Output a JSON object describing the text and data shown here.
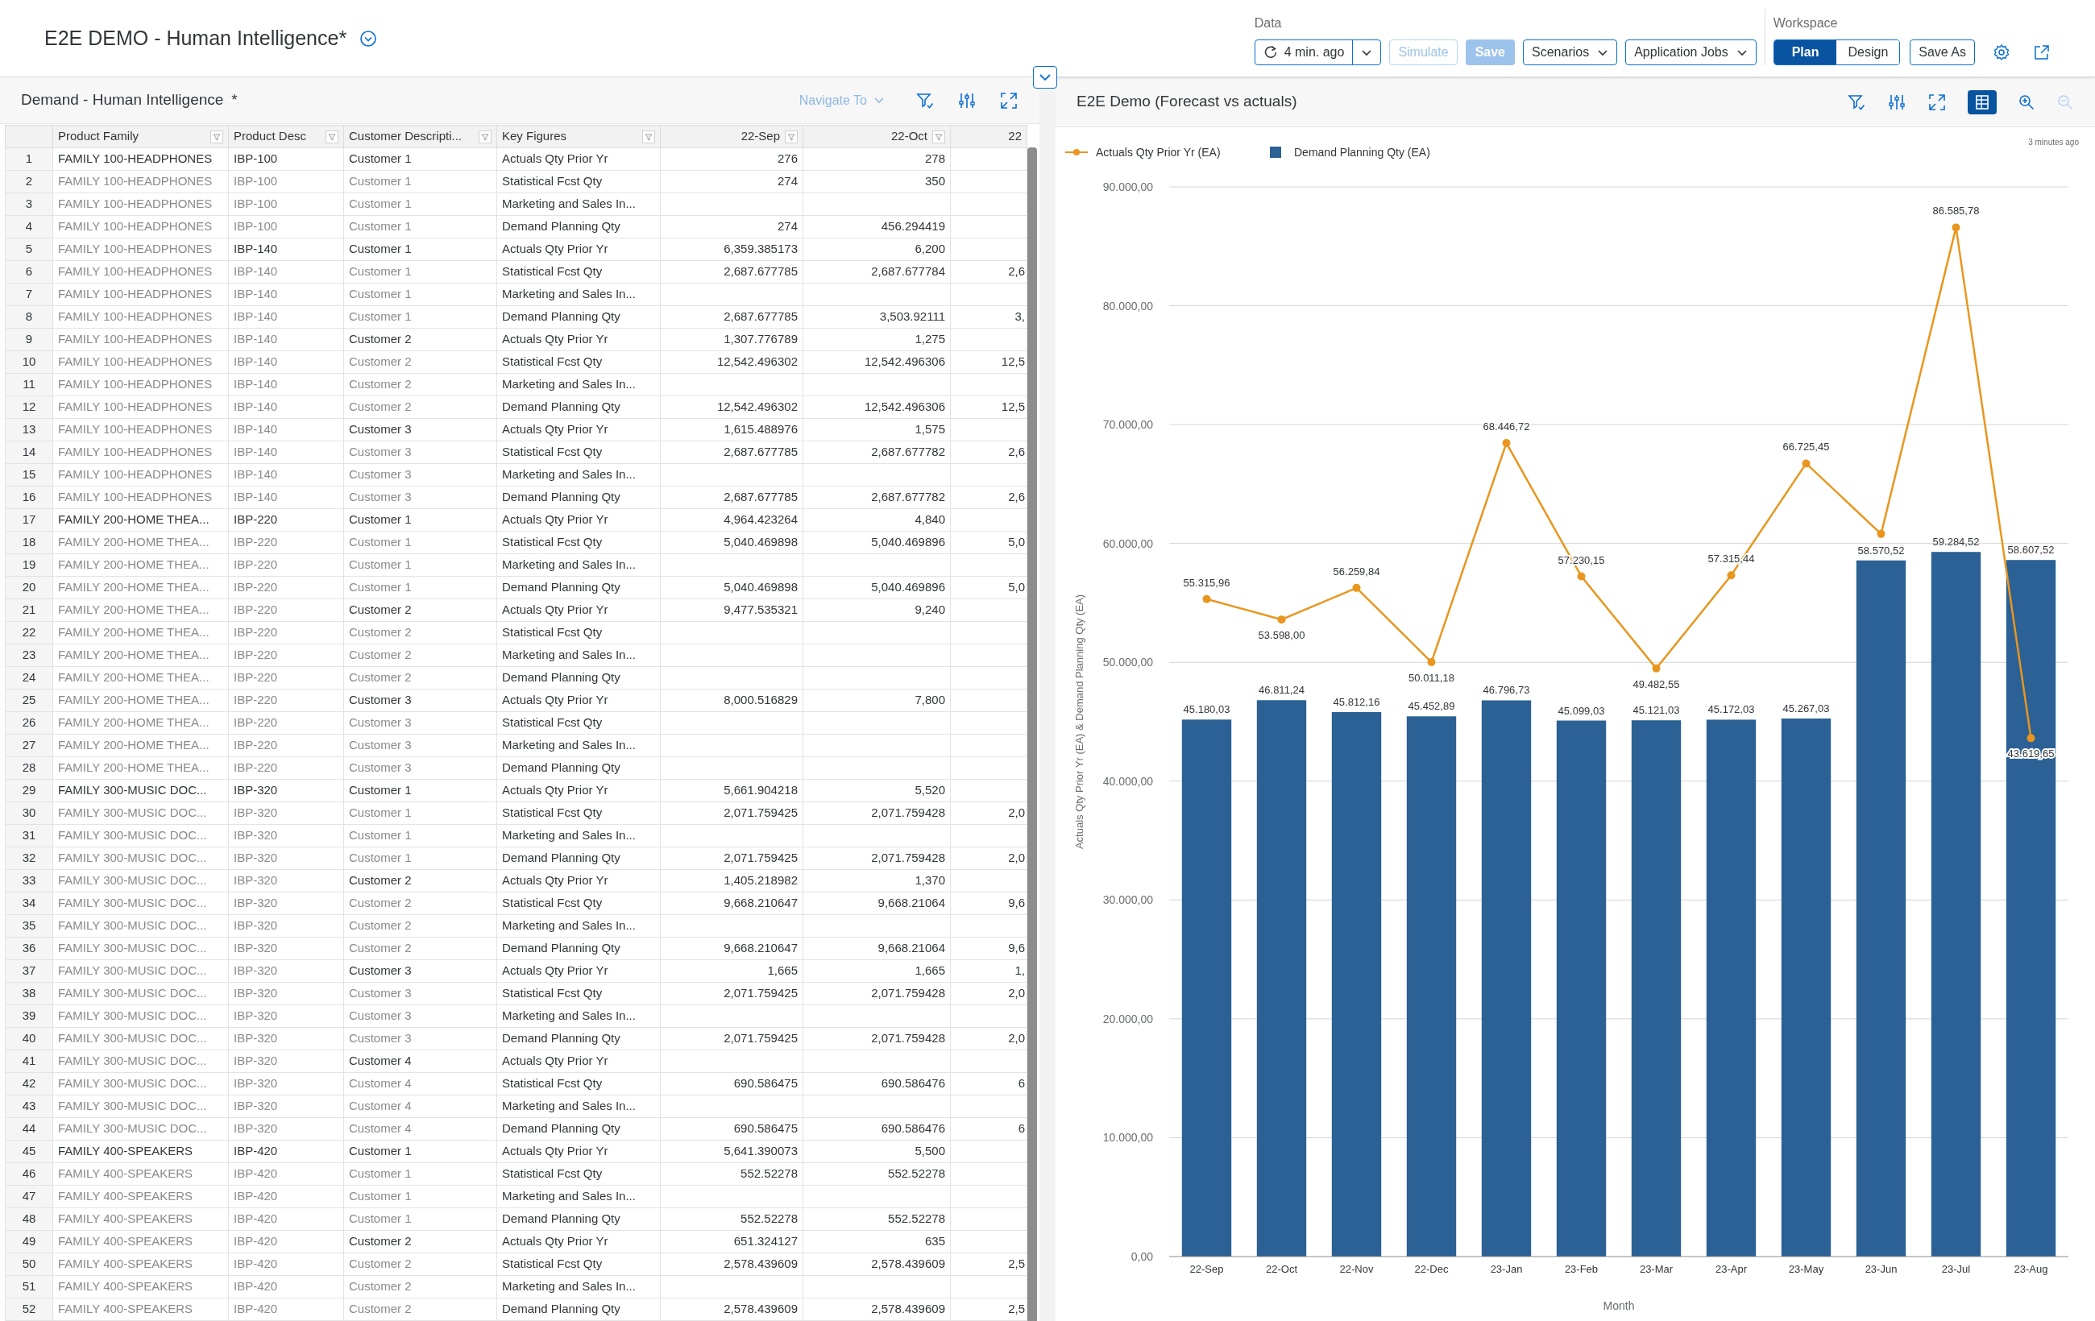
{
  "page": {
    "title": "E2E DEMO - Human Intelligence*"
  },
  "toolbar": {
    "data_group": {
      "label": "Data",
      "refresh_label": "4 min. ago",
      "simulate": {
        "label": "Simulate",
        "disabled": true
      },
      "save": {
        "label": "Save",
        "disabled": true
      },
      "menus": [
        "Scenarios",
        "Application Jobs"
      ]
    },
    "workspace_group": {
      "label": "Workspace",
      "modes": [
        {
          "label": "Plan",
          "selected": true
        },
        {
          "label": "Design",
          "selected": false
        }
      ],
      "save_as": "Save As"
    }
  },
  "table_panel": {
    "title": "Demand - Human Intelligence",
    "modified_mark": "*",
    "navigate_to": "Navigate To",
    "columns": [
      "Product Family",
      "Product Desc",
      "Customer Descripti...",
      "Key Figures",
      "22-Sep",
      "22-Oct",
      "22"
    ],
    "rows": [
      {
        "n": "1",
        "cells": [
          "FAMILY 100-HEADPHONES",
          "IBP-100",
          "Customer 1",
          "Actuals Qty Prior Yr",
          "276",
          "278",
          null
        ],
        "dim": [
          false,
          false,
          false
        ]
      },
      {
        "n": "2",
        "cells": [
          "FAMILY 100-HEADPHONES",
          "IBP-100",
          "Customer 1",
          "Statistical Fcst Qty",
          "274",
          "350",
          null
        ],
        "dim": [
          true,
          true,
          true
        ]
      },
      {
        "n": "3",
        "cells": [
          "FAMILY 100-HEADPHONES",
          "IBP-100",
          "Customer 1",
          "Marketing and Sales In...",
          null,
          null,
          null
        ],
        "dim": [
          true,
          true,
          true
        ]
      },
      {
        "n": "4",
        "cells": [
          "FAMILY 100-HEADPHONES",
          "IBP-100",
          "Customer 1",
          "Demand Planning Qty",
          "274",
          "456.294419",
          null
        ],
        "dim": [
          true,
          true,
          true
        ]
      },
      {
        "n": "5",
        "cells": [
          "FAMILY 100-HEADPHONES",
          "IBP-140",
          "Customer 1",
          "Actuals Qty Prior Yr",
          "6,359.385173",
          "6,200",
          null
        ],
        "dim": [
          true,
          false,
          false
        ]
      },
      {
        "n": "6",
        "cells": [
          "FAMILY 100-HEADPHONES",
          "IBP-140",
          "Customer 1",
          "Statistical Fcst Qty",
          "2,687.677785",
          "2,687.677784",
          "2,6"
        ],
        "dim": [
          true,
          true,
          true
        ]
      },
      {
        "n": "7",
        "cells": [
          "FAMILY 100-HEADPHONES",
          "IBP-140",
          "Customer 1",
          "Marketing and Sales In...",
          null,
          null,
          null
        ],
        "dim": [
          true,
          true,
          true
        ]
      },
      {
        "n": "8",
        "cells": [
          "FAMILY 100-HEADPHONES",
          "IBP-140",
          "Customer 1",
          "Demand Planning Qty",
          "2,687.677785",
          "3,503.92111",
          "3,"
        ],
        "dim": [
          true,
          true,
          true
        ]
      },
      {
        "n": "9",
        "cells": [
          "FAMILY 100-HEADPHONES",
          "IBP-140",
          "Customer 2",
          "Actuals Qty Prior Yr",
          "1,307.776789",
          "1,275",
          null
        ],
        "dim": [
          true,
          true,
          false
        ]
      },
      {
        "n": "10",
        "cells": [
          "FAMILY 100-HEADPHONES",
          "IBP-140",
          "Customer 2",
          "Statistical Fcst Qty",
          "12,542.496302",
          "12,542.496306",
          "12,5"
        ],
        "dim": [
          true,
          true,
          true
        ]
      },
      {
        "n": "11",
        "cells": [
          "FAMILY 100-HEADPHONES",
          "IBP-140",
          "Customer 2",
          "Marketing and Sales In...",
          null,
          null,
          null
        ],
        "dim": [
          true,
          true,
          true
        ]
      },
      {
        "n": "12",
        "cells": [
          "FAMILY 100-HEADPHONES",
          "IBP-140",
          "Customer 2",
          "Demand Planning Qty",
          "12,542.496302",
          "12,542.496306",
          "12,5"
        ],
        "dim": [
          true,
          true,
          true
        ]
      },
      {
        "n": "13",
        "cells": [
          "FAMILY 100-HEADPHONES",
          "IBP-140",
          "Customer 3",
          "Actuals Qty Prior Yr",
          "1,615.488976",
          "1,575",
          null
        ],
        "dim": [
          true,
          true,
          false
        ]
      },
      {
        "n": "14",
        "cells": [
          "FAMILY 100-HEADPHONES",
          "IBP-140",
          "Customer 3",
          "Statistical Fcst Qty",
          "2,687.677785",
          "2,687.677782",
          "2,6"
        ],
        "dim": [
          true,
          true,
          true
        ]
      },
      {
        "n": "15",
        "cells": [
          "FAMILY 100-HEADPHONES",
          "IBP-140",
          "Customer 3",
          "Marketing and Sales In...",
          null,
          null,
          null
        ],
        "dim": [
          true,
          true,
          true
        ]
      },
      {
        "n": "16",
        "cells": [
          "FAMILY 100-HEADPHONES",
          "IBP-140",
          "Customer 3",
          "Demand Planning Qty",
          "2,687.677785",
          "2,687.677782",
          "2,6"
        ],
        "dim": [
          true,
          true,
          true
        ]
      },
      {
        "n": "17",
        "cells": [
          "FAMILY 200-HOME THEA...",
          "IBP-220",
          "Customer 1",
          "Actuals Qty Prior Yr",
          "4,964.423264",
          "4,840",
          null
        ],
        "dim": [
          false,
          false,
          false
        ]
      },
      {
        "n": "18",
        "cells": [
          "FAMILY 200-HOME THEA...",
          "IBP-220",
          "Customer 1",
          "Statistical Fcst Qty",
          "5,040.469898",
          "5,040.469896",
          "5,0"
        ],
        "dim": [
          true,
          true,
          true
        ]
      },
      {
        "n": "19",
        "cells": [
          "FAMILY 200-HOME THEA...",
          "IBP-220",
          "Customer 1",
          "Marketing and Sales In...",
          null,
          null,
          null
        ],
        "dim": [
          true,
          true,
          true
        ]
      },
      {
        "n": "20",
        "cells": [
          "FAMILY 200-HOME THEA...",
          "IBP-220",
          "Customer 1",
          "Demand Planning Qty",
          "5,040.469898",
          "5,040.469896",
          "5,0"
        ],
        "dim": [
          true,
          true,
          true
        ]
      },
      {
        "n": "21",
        "cells": [
          "FAMILY 200-HOME THEA...",
          "IBP-220",
          "Customer 2",
          "Actuals Qty Prior Yr",
          "9,477.535321",
          "9,240",
          null
        ],
        "dim": [
          true,
          true,
          false
        ]
      },
      {
        "n": "22",
        "cells": [
          "FAMILY 200-HOME THEA...",
          "IBP-220",
          "Customer 2",
          "Statistical Fcst Qty",
          null,
          null,
          null
        ],
        "dim": [
          true,
          true,
          true
        ]
      },
      {
        "n": "23",
        "cells": [
          "FAMILY 200-HOME THEA...",
          "IBP-220",
          "Customer 2",
          "Marketing and Sales In...",
          null,
          null,
          null
        ],
        "dim": [
          true,
          true,
          true
        ]
      },
      {
        "n": "24",
        "cells": [
          "FAMILY 200-HOME THEA...",
          "IBP-220",
          "Customer 2",
          "Demand Planning Qty",
          null,
          null,
          null
        ],
        "dim": [
          true,
          true,
          true
        ]
      },
      {
        "n": "25",
        "cells": [
          "FAMILY 200-HOME THEA...",
          "IBP-220",
          "Customer 3",
          "Actuals Qty Prior Yr",
          "8,000.516829",
          "7,800",
          null
        ],
        "dim": [
          true,
          true,
          false
        ]
      },
      {
        "n": "26",
        "cells": [
          "FAMILY 200-HOME THEA...",
          "IBP-220",
          "Customer 3",
          "Statistical Fcst Qty",
          null,
          null,
          null
        ],
        "dim": [
          true,
          true,
          true
        ]
      },
      {
        "n": "27",
        "cells": [
          "FAMILY 200-HOME THEA...",
          "IBP-220",
          "Customer 3",
          "Marketing and Sales In...",
          null,
          null,
          null
        ],
        "dim": [
          true,
          true,
          true
        ]
      },
      {
        "n": "28",
        "cells": [
          "FAMILY 200-HOME THEA...",
          "IBP-220",
          "Customer 3",
          "Demand Planning Qty",
          null,
          null,
          null
        ],
        "dim": [
          true,
          true,
          true
        ]
      },
      {
        "n": "29",
        "cells": [
          "FAMILY 300-MUSIC DOC...",
          "IBP-320",
          "Customer 1",
          "Actuals Qty Prior Yr",
          "5,661.904218",
          "5,520",
          null
        ],
        "dim": [
          false,
          false,
          false
        ]
      },
      {
        "n": "30",
        "cells": [
          "FAMILY 300-MUSIC DOC...",
          "IBP-320",
          "Customer 1",
          "Statistical Fcst Qty",
          "2,071.759425",
          "2,071.759428",
          "2,0"
        ],
        "dim": [
          true,
          true,
          true
        ]
      },
      {
        "n": "31",
        "cells": [
          "FAMILY 300-MUSIC DOC...",
          "IBP-320",
          "Customer 1",
          "Marketing and Sales In...",
          null,
          null,
          null
        ],
        "dim": [
          true,
          true,
          true
        ]
      },
      {
        "n": "32",
        "cells": [
          "FAMILY 300-MUSIC DOC...",
          "IBP-320",
          "Customer 1",
          "Demand Planning Qty",
          "2,071.759425",
          "2,071.759428",
          "2,0"
        ],
        "dim": [
          true,
          true,
          true
        ]
      },
      {
        "n": "33",
        "cells": [
          "FAMILY 300-MUSIC DOC...",
          "IBP-320",
          "Customer 2",
          "Actuals Qty Prior Yr",
          "1,405.218982",
          "1,370",
          null
        ],
        "dim": [
          true,
          true,
          false
        ]
      },
      {
        "n": "34",
        "cells": [
          "FAMILY 300-MUSIC DOC...",
          "IBP-320",
          "Customer 2",
          "Statistical Fcst Qty",
          "9,668.210647",
          "9,668.21064",
          "9,6"
        ],
        "dim": [
          true,
          true,
          true
        ]
      },
      {
        "n": "35",
        "cells": [
          "FAMILY 300-MUSIC DOC...",
          "IBP-320",
          "Customer 2",
          "Marketing and Sales In...",
          null,
          null,
          null
        ],
        "dim": [
          true,
          true,
          true
        ]
      },
      {
        "n": "36",
        "cells": [
          "FAMILY 300-MUSIC DOC...",
          "IBP-320",
          "Customer 2",
          "Demand Planning Qty",
          "9,668.210647",
          "9,668.21064",
          "9,6"
        ],
        "dim": [
          true,
          true,
          true
        ]
      },
      {
        "n": "37",
        "cells": [
          "FAMILY 300-MUSIC DOC...",
          "IBP-320",
          "Customer 3",
          "Actuals Qty Prior Yr",
          "1,665",
          "1,665",
          "1,"
        ],
        "dim": [
          true,
          true,
          false
        ]
      },
      {
        "n": "38",
        "cells": [
          "FAMILY 300-MUSIC DOC...",
          "IBP-320",
          "Customer 3",
          "Statistical Fcst Qty",
          "2,071.759425",
          "2,071.759428",
          "2,0"
        ],
        "dim": [
          true,
          true,
          true
        ]
      },
      {
        "n": "39",
        "cells": [
          "FAMILY 300-MUSIC DOC...",
          "IBP-320",
          "Customer 3",
          "Marketing and Sales In...",
          null,
          null,
          null
        ],
        "dim": [
          true,
          true,
          true
        ]
      },
      {
        "n": "40",
        "cells": [
          "FAMILY 300-MUSIC DOC...",
          "IBP-320",
          "Customer 3",
          "Demand Planning Qty",
          "2,071.759425",
          "2,071.759428",
          "2,0"
        ],
        "dim": [
          true,
          true,
          true
        ]
      },
      {
        "n": "41",
        "cells": [
          "FAMILY 300-MUSIC DOC...",
          "IBP-320",
          "Customer 4",
          "Actuals Qty Prior Yr",
          null,
          null,
          null
        ],
        "dim": [
          true,
          true,
          false
        ]
      },
      {
        "n": "42",
        "cells": [
          "FAMILY 300-MUSIC DOC...",
          "IBP-320",
          "Customer 4",
          "Statistical Fcst Qty",
          "690.586475",
          "690.586476",
          "6"
        ],
        "dim": [
          true,
          true,
          true
        ]
      },
      {
        "n": "43",
        "cells": [
          "FAMILY 300-MUSIC DOC...",
          "IBP-320",
          "Customer 4",
          "Marketing and Sales In...",
          null,
          null,
          null
        ],
        "dim": [
          true,
          true,
          true
        ]
      },
      {
        "n": "44",
        "cells": [
          "FAMILY 300-MUSIC DOC...",
          "IBP-320",
          "Customer 4",
          "Demand Planning Qty",
          "690.586475",
          "690.586476",
          "6"
        ],
        "dim": [
          true,
          true,
          true
        ]
      },
      {
        "n": "45",
        "cells": [
          "FAMILY 400-SPEAKERS",
          "IBP-420",
          "Customer 1",
          "Actuals Qty Prior Yr",
          "5,641.390073",
          "5,500",
          null
        ],
        "dim": [
          false,
          false,
          false
        ]
      },
      {
        "n": "46",
        "cells": [
          "FAMILY 400-SPEAKERS",
          "IBP-420",
          "Customer 1",
          "Statistical Fcst Qty",
          "552.52278",
          "552.52278",
          null
        ],
        "dim": [
          true,
          true,
          true
        ]
      },
      {
        "n": "47",
        "cells": [
          "FAMILY 400-SPEAKERS",
          "IBP-420",
          "Customer 1",
          "Marketing and Sales In...",
          null,
          null,
          null
        ],
        "dim": [
          true,
          true,
          true
        ]
      },
      {
        "n": "48",
        "cells": [
          "FAMILY 400-SPEAKERS",
          "IBP-420",
          "Customer 1",
          "Demand Planning Qty",
          "552.52278",
          "552.52278",
          null
        ],
        "dim": [
          true,
          true,
          true
        ]
      },
      {
        "n": "49",
        "cells": [
          "FAMILY 400-SPEAKERS",
          "IBP-420",
          "Customer 2",
          "Actuals Qty Prior Yr",
          "651.324127",
          "635",
          null
        ],
        "dim": [
          true,
          true,
          false
        ]
      },
      {
        "n": "50",
        "cells": [
          "FAMILY 400-SPEAKERS",
          "IBP-420",
          "Customer 2",
          "Statistical Fcst Qty",
          "2,578.439609",
          "2,578.439609",
          "2,5"
        ],
        "dim": [
          true,
          true,
          true
        ]
      },
      {
        "n": "51",
        "cells": [
          "FAMILY 400-SPEAKERS",
          "IBP-420",
          "Customer 2",
          "Marketing and Sales In...",
          null,
          null,
          null
        ],
        "dim": [
          true,
          true,
          true
        ]
      },
      {
        "n": "52",
        "cells": [
          "FAMILY 400-SPEAKERS",
          "IBP-420",
          "Customer 2",
          "Demand Planning Qty",
          "2,578.439609",
          "2,578.439609",
          "2,5"
        ],
        "dim": [
          true,
          true,
          true
        ]
      }
    ]
  },
  "chart_panel": {
    "title": "E2E Demo (Forecast vs actuals)",
    "table_view_selected": true,
    "zoom_out_disabled": true,
    "timestamp": "3 minutes ago",
    "chart_data": {
      "type": "bar",
      "xlabel": "Month",
      "ylabel": "Actuals Qty Prior Yr (EA) & Demand Planning Qty (EA)",
      "categories": [
        "22-Sep",
        "22-Oct",
        "22-Nov",
        "22-Dec",
        "23-Jan",
        "23-Feb",
        "23-Mar",
        "23-Apr",
        "23-May",
        "23-Jun",
        "23-Jul",
        "23-Aug"
      ],
      "series": [
        {
          "name": "Actuals Qty Prior Yr (EA)",
          "type": "line",
          "marker": true,
          "color": "#e8961e",
          "values": [
            55315.96,
            53598.0,
            56259.84,
            50011.18,
            68446.72,
            57230.15,
            49482.55,
            57315.44,
            66725.45,
            60800,
            86585.78,
            43619.65
          ],
          "value_labels": [
            "55.315,96",
            "53.598,00",
            "56.259,84",
            "50.011,18",
            "68.446,72",
            "57.230,15",
            "49.482,55",
            "57.315,44",
            "66.725,45",
            null,
            "86.585,78",
            "43.619,65"
          ]
        },
        {
          "name": "Demand Planning Qty (EA)",
          "type": "bar",
          "color": "#2b6194",
          "values": [
            45180.03,
            46811.24,
            45812.16,
            45452.89,
            46796.73,
            45099.03,
            45121.03,
            45172.03,
            45267.03,
            58570.52,
            59284.52,
            58607.52
          ],
          "value_labels": [
            "45.180,03",
            "46.811,24",
            "45.812,16",
            "45.452,89",
            "46.796,73",
            "45.099,03",
            "45.121,03",
            "45.172,03",
            "45.267,03",
            "58.570,52",
            "59.284,52",
            "58.607,52"
          ]
        }
      ],
      "ylim": [
        0,
        90000
      ],
      "yticks": [
        {
          "value": 0,
          "label": "0,00"
        },
        {
          "value": 10000,
          "label": "10.000,00"
        },
        {
          "value": 20000,
          "label": "20.000,00"
        },
        {
          "value": 30000,
          "label": "30.000,00"
        },
        {
          "value": 40000,
          "label": "40.000,00"
        },
        {
          "value": 50000,
          "label": "50.000,00"
        },
        {
          "value": 60000,
          "label": "60.000,00"
        },
        {
          "value": 70000,
          "label": "70.000,00"
        },
        {
          "value": 80000,
          "label": "80.000,00"
        },
        {
          "value": 90000,
          "label": "90.000,00"
        }
      ],
      "data_labels": true,
      "grid": true,
      "legend": true
    }
  }
}
